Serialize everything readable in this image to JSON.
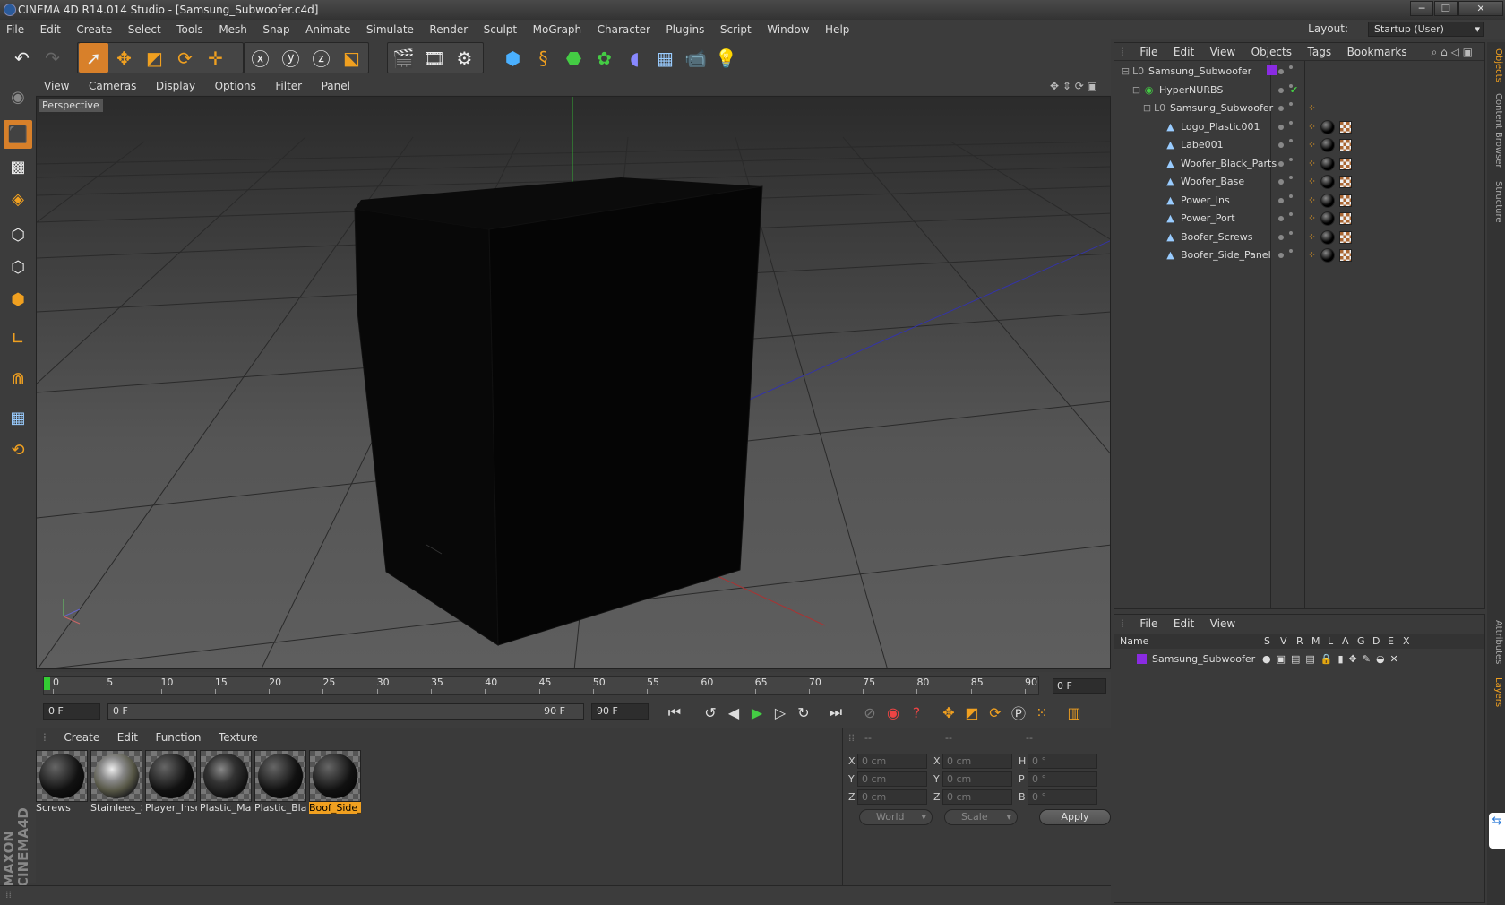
{
  "window": {
    "title": "CINEMA 4D R14.014 Studio - [Samsung_Subwoofer.c4d]",
    "controls": [
      "─",
      "❐",
      "✕"
    ]
  },
  "menubar": [
    "File",
    "Edit",
    "Create",
    "Select",
    "Tools",
    "Mesh",
    "Snap",
    "Animate",
    "Simulate",
    "Render",
    "Sculpt",
    "MoGraph",
    "Character",
    "Plugins",
    "Script",
    "Window",
    "Help"
  ],
  "layout": {
    "label": "Layout:",
    "value": "Startup (User)"
  },
  "viewport": {
    "menu": [
      "View",
      "Cameras",
      "Display",
      "Options",
      "Filter",
      "Panel"
    ],
    "label": "Perspective"
  },
  "timeline": {
    "ticks": [
      "0",
      "5",
      "10",
      "15",
      "20",
      "25",
      "30",
      "35",
      "40",
      "45",
      "50",
      "55",
      "60",
      "65",
      "70",
      "75",
      "80",
      "85",
      "90"
    ],
    "current_frame": "0 F"
  },
  "transport": {
    "start": "0 F",
    "range_start": "0 F",
    "range_end": "90 F",
    "end": "90 F"
  },
  "materials": {
    "menu": [
      "Create",
      "Edit",
      "Function",
      "Texture"
    ],
    "items": [
      {
        "label": "Screws",
        "style": "black"
      },
      {
        "label": "Stainlees_S",
        "style": "chrome"
      },
      {
        "label": "Player_Inse",
        "style": "black"
      },
      {
        "label": "Plastic_Mat",
        "style": "dchrome"
      },
      {
        "label": "Plastic_Blac",
        "style": "black"
      },
      {
        "label": "Boof_Side_",
        "style": "black",
        "selected": true
      }
    ]
  },
  "coords": {
    "headers": [
      "--",
      "--",
      "--"
    ],
    "rows": [
      {
        "a": "X",
        "av": "0 cm",
        "b": "X",
        "bv": "0 cm",
        "c": "H",
        "cv": "0 °"
      },
      {
        "a": "Y",
        "av": "0 cm",
        "b": "Y",
        "bv": "0 cm",
        "c": "P",
        "cv": "0 °"
      },
      {
        "a": "Z",
        "av": "0 cm",
        "b": "Z",
        "bv": "0 cm",
        "c": "B",
        "cv": "0 °"
      }
    ],
    "mode1": "World",
    "mode2": "Scale",
    "apply": "Apply"
  },
  "objects": {
    "menu": [
      "File",
      "Edit",
      "View",
      "Objects",
      "Tags",
      "Bookmarks"
    ],
    "tree": [
      {
        "name": "Samsung_Subwoofer",
        "depth": 0,
        "type": "null"
      },
      {
        "name": "HyperNURBS",
        "depth": 1,
        "type": "nurbs"
      },
      {
        "name": "Samsung_Subwoofer",
        "depth": 2,
        "type": "null"
      },
      {
        "name": "Logo_Plastic001",
        "depth": 3,
        "type": "poly"
      },
      {
        "name": "Labe001",
        "depth": 3,
        "type": "poly"
      },
      {
        "name": "Woofer_Black_Parts",
        "depth": 3,
        "type": "poly"
      },
      {
        "name": "Woofer_Base",
        "depth": 3,
        "type": "poly"
      },
      {
        "name": "Power_Ins",
        "depth": 3,
        "type": "poly"
      },
      {
        "name": "Power_Port",
        "depth": 3,
        "type": "poly"
      },
      {
        "name": "Boofer_Screws",
        "depth": 3,
        "type": "poly"
      },
      {
        "name": "Boofer_Side_Panel",
        "depth": 3,
        "type": "poly"
      }
    ]
  },
  "layers": {
    "menu": [
      "File",
      "Edit",
      "View"
    ],
    "columns": [
      "Name",
      "S",
      "V",
      "R",
      "M",
      "L",
      "A",
      "G",
      "D",
      "E",
      "X"
    ],
    "items": [
      {
        "name": "Samsung_Subwoofer",
        "color": "#8a2be2"
      }
    ]
  },
  "sidetabs": [
    "Objects",
    "Content Browser",
    "Structure",
    "Attributes",
    "Layers"
  ],
  "colors": {
    "accent": "#d8802a",
    "selected_material": "#f0a020"
  }
}
